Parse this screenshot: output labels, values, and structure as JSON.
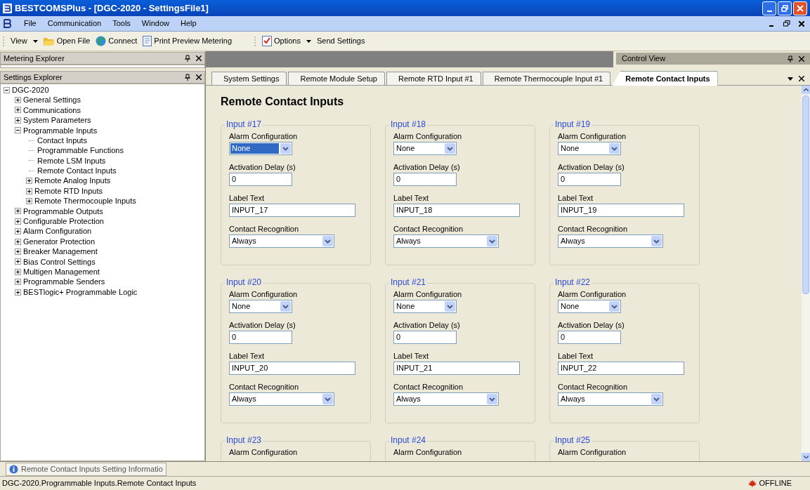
{
  "window": {
    "title": "BESTCOMSPlus - [DGC-2020 - SettingsFile1]"
  },
  "menu": [
    "File",
    "Communication",
    "Tools",
    "Window",
    "Help"
  ],
  "toolbar": {
    "left": [
      {
        "label": "View",
        "kind": "dropdown"
      },
      {
        "label": "Open File",
        "kind": "open"
      },
      {
        "label": "Connect",
        "kind": "connect"
      },
      {
        "label": "Print Preview Metering",
        "kind": "print"
      }
    ],
    "right": [
      {
        "label": "Options",
        "kind": "options"
      },
      {
        "label": "Send Settings",
        "kind": "plain"
      }
    ]
  },
  "metering_explorer": {
    "title": "Metering Explorer"
  },
  "control_view": {
    "title": "Control View"
  },
  "settings_explorer": {
    "title": "Settings Explorer",
    "tree": [
      {
        "label": "DGC-2020",
        "expanded": true,
        "children": [
          {
            "label": "General Settings",
            "expanded": false
          },
          {
            "label": "Communications",
            "expanded": false
          },
          {
            "label": "System Parameters",
            "expanded": false
          },
          {
            "label": "Programmable Inputs",
            "expanded": true,
            "children": [
              {
                "label": "Contact Inputs"
              },
              {
                "label": "Programmable Functions"
              },
              {
                "label": "Remote LSM Inputs"
              },
              {
                "label": "Remote Contact Inputs"
              },
              {
                "label": "Remote Analog Inputs",
                "expanded": false
              },
              {
                "label": "Remote RTD Inputs",
                "expanded": false
              },
              {
                "label": "Remote Thermocouple Inputs",
                "expanded": false
              }
            ]
          },
          {
            "label": "Programmable Outputs",
            "expanded": false
          },
          {
            "label": "Configurable Protection",
            "expanded": false
          },
          {
            "label": "Alarm Configuration",
            "expanded": false
          },
          {
            "label": "Generator Protection",
            "expanded": false
          },
          {
            "label": "Breaker Management",
            "expanded": false
          },
          {
            "label": "Bias Control Settings",
            "expanded": false
          },
          {
            "label": "Multigen Management",
            "expanded": false
          },
          {
            "label": "Programmable Senders",
            "expanded": false
          },
          {
            "label": "BESTlogic+ Programmable Logic",
            "expanded": false
          }
        ]
      }
    ]
  },
  "tabs": [
    {
      "label": "System Settings",
      "selected": false
    },
    {
      "label": "Remote Module Setup",
      "selected": false
    },
    {
      "label": "Remote RTD Input #1",
      "selected": false
    },
    {
      "label": "Remote Thermocouple Input #1",
      "selected": false
    },
    {
      "label": "Remote Contact Inputs",
      "selected": true
    }
  ],
  "page_title": "Remote Contact Inputs",
  "inputs": [
    {
      "title": "Input #17",
      "alarm_label": "Alarm Configuration",
      "alarm": "None",
      "alarm_focused": true,
      "delay_label": "Activation Delay (s)",
      "delay": "0",
      "text_label": "Label Text",
      "text": "INPUT_17",
      "recognition_label": "Contact Recognition",
      "recognition": "Always"
    },
    {
      "title": "Input #18",
      "alarm_label": "Alarm Configuration",
      "alarm": "None",
      "alarm_focused": false,
      "delay_label": "Activation Delay (s)",
      "delay": "0",
      "text_label": "Label Text",
      "text": "INPUT_18",
      "recognition_label": "Contact Recognition",
      "recognition": "Always"
    },
    {
      "title": "Input #19",
      "alarm_label": "Alarm Configuration",
      "alarm": "None",
      "alarm_focused": false,
      "delay_label": "Activation Delay (s)",
      "delay": "0",
      "text_label": "Label Text",
      "text": "INPUT_19",
      "recognition_label": "Contact Recognition",
      "recognition": "Always"
    },
    {
      "title": "Input #20",
      "alarm_label": "Alarm Configuration",
      "alarm": "None",
      "alarm_focused": false,
      "delay_label": "Activation Delay (s)",
      "delay": "0",
      "text_label": "Label Text",
      "text": "INPUT_20",
      "recognition_label": "Contact Recognition",
      "recognition": "Always"
    },
    {
      "title": "Input #21",
      "alarm_label": "Alarm Configuration",
      "alarm": "None",
      "alarm_focused": false,
      "delay_label": "Activation Delay (s)",
      "delay": "0",
      "text_label": "Label Text",
      "text": "INPUT_21",
      "recognition_label": "Contact Recognition",
      "recognition": "Always"
    },
    {
      "title": "Input #22",
      "alarm_label": "Alarm Configuration",
      "alarm": "None",
      "alarm_focused": false,
      "delay_label": "Activation Delay (s)",
      "delay": "0",
      "text_label": "Label Text",
      "text": "INPUT_22",
      "recognition_label": "Contact Recognition",
      "recognition": "Always"
    },
    {
      "title": "Input #23",
      "alarm_label": "Alarm Configuration"
    },
    {
      "title": "Input #24",
      "alarm_label": "Alarm Configuration"
    },
    {
      "title": "Input #25",
      "alarm_label": "Alarm Configuration"
    }
  ],
  "info_tab": {
    "label": "Remote Contact Inputs Setting Informatio"
  },
  "status_bar": {
    "path": "DGC-2020.Programmable Inputs.Remote Contact Inputs",
    "connection": "OFFLINE"
  }
}
